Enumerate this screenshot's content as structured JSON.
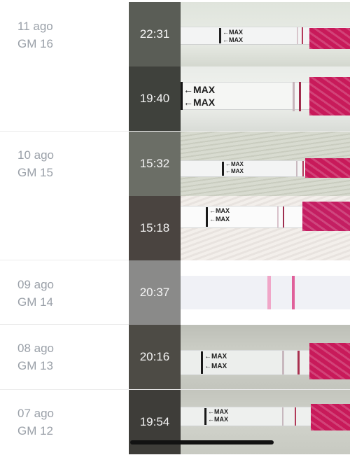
{
  "groups": [
    {
      "day": "11 ago",
      "gm": "GM 16",
      "entries": [
        {
          "time": "22:31",
          "photo_icon": "ovulation-test-strip-photo",
          "max_label": "←MAX"
        },
        {
          "time": "19:40",
          "photo_icon": "ovulation-test-strip-photo",
          "max_label": "←MAX"
        }
      ]
    },
    {
      "day": "10 ago",
      "gm": "GM 15",
      "entries": [
        {
          "time": "15:32",
          "photo_icon": "ovulation-test-strip-photo",
          "max_label": "←MAX"
        },
        {
          "time": "15:18",
          "photo_icon": "ovulation-test-strip-photo",
          "max_label": "←MAX"
        }
      ]
    },
    {
      "day": "09 ago",
      "gm": "GM 14",
      "entries": [
        {
          "time": "20:37",
          "photo_icon": "ovulation-test-strip-result",
          "max_label": ""
        }
      ]
    },
    {
      "day": "08 ago",
      "gm": "GM 13",
      "entries": [
        {
          "time": "20:16",
          "photo_icon": "ovulation-test-strip-photo",
          "max_label": "←MAX"
        }
      ]
    },
    {
      "day": "07 ago",
      "gm": "GM 12",
      "entries": [
        {
          "time": "19:54",
          "photo_icon": "ovulation-test-strip-photo",
          "max_label": "←MAX"
        }
      ]
    }
  ],
  "colors": {
    "date_text": "#9aa0a8",
    "test_line": "#c0335f",
    "control_line_pink": "#e0609a",
    "dye_pad": "#c81a5a"
  }
}
